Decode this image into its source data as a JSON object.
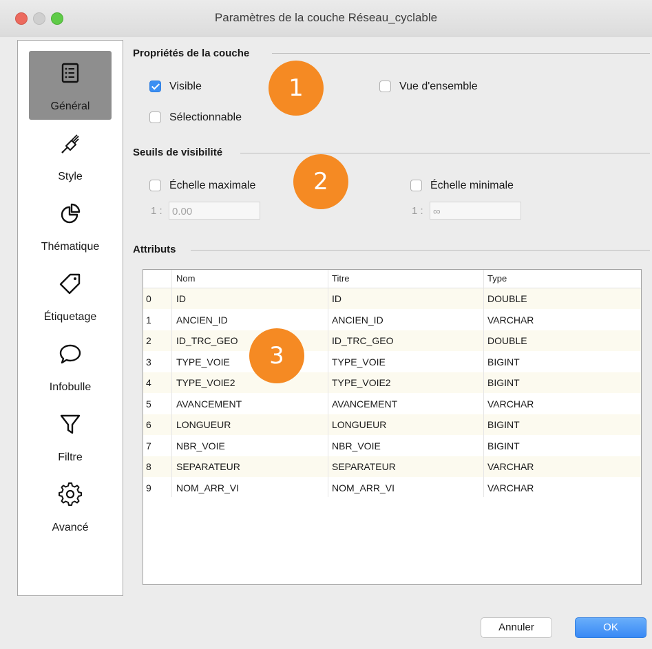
{
  "window": {
    "title": "Paramètres de la couche Réseau_cyclable"
  },
  "sidebar": {
    "items": [
      {
        "label": "Général",
        "icon": "list-icon",
        "active": true
      },
      {
        "label": "Style",
        "icon": "paintbrush-icon",
        "active": false
      },
      {
        "label": "Thématique",
        "icon": "pie-chart-icon",
        "active": false
      },
      {
        "label": "Étiquetage",
        "icon": "tag-icon",
        "active": false
      },
      {
        "label": "Infobulle",
        "icon": "speech-bubble-icon",
        "active": false
      },
      {
        "label": "Filtre",
        "icon": "funnel-icon",
        "active": false
      },
      {
        "label": "Avancé",
        "icon": "gear-icon",
        "active": false
      }
    ]
  },
  "properties": {
    "title": "Propriétés de la couche",
    "visible": {
      "label": "Visible",
      "checked": true
    },
    "overview": {
      "label": "Vue d'ensemble",
      "checked": false
    },
    "selectable": {
      "label": "Sélectionnable",
      "checked": false
    }
  },
  "thresholds": {
    "title": "Seuils de visibilité",
    "max_scale": {
      "label": "Échelle maximale",
      "checked": false,
      "prefix": "1 :",
      "value": "0.00"
    },
    "min_scale": {
      "label": "Échelle minimale",
      "checked": false,
      "prefix": "1 :",
      "value": "∞"
    }
  },
  "attributes": {
    "title": "Attributs",
    "columns": [
      "Nom",
      "Titre",
      "Type"
    ],
    "rows": [
      {
        "index": "0",
        "nom": "ID",
        "titre": "ID",
        "type": "DOUBLE"
      },
      {
        "index": "1",
        "nom": "ANCIEN_ID",
        "titre": "ANCIEN_ID",
        "type": "VARCHAR"
      },
      {
        "index": "2",
        "nom": "ID_TRC_GEO",
        "titre": "ID_TRC_GEO",
        "type": "DOUBLE"
      },
      {
        "index": "3",
        "nom": "TYPE_VOIE",
        "titre": "TYPE_VOIE",
        "type": "BIGINT"
      },
      {
        "index": "4",
        "nom": "TYPE_VOIE2",
        "titre": "TYPE_VOIE2",
        "type": "BIGINT"
      },
      {
        "index": "5",
        "nom": "AVANCEMENT",
        "titre": "AVANCEMENT",
        "type": "VARCHAR"
      },
      {
        "index": "6",
        "nom": "LONGUEUR",
        "titre": "LONGUEUR",
        "type": "BIGINT"
      },
      {
        "index": "7",
        "nom": "NBR_VOIE",
        "titre": "NBR_VOIE",
        "type": "BIGINT"
      },
      {
        "index": "8",
        "nom": "SEPARATEUR",
        "titre": "SEPARATEUR",
        "type": "VARCHAR"
      },
      {
        "index": "9",
        "nom": "NOM_ARR_VI",
        "titre": "NOM_ARR_VI",
        "type": "VARCHAR"
      }
    ]
  },
  "badges": {
    "one": "1",
    "two": "2",
    "three": "3"
  },
  "buttons": {
    "cancel": "Annuler",
    "ok": "OK"
  },
  "colors": {
    "accent": "#3b8ff3",
    "badge": "#f58a23",
    "active_nav": "#8e8e8e",
    "row_alt": "#fcfaef"
  }
}
